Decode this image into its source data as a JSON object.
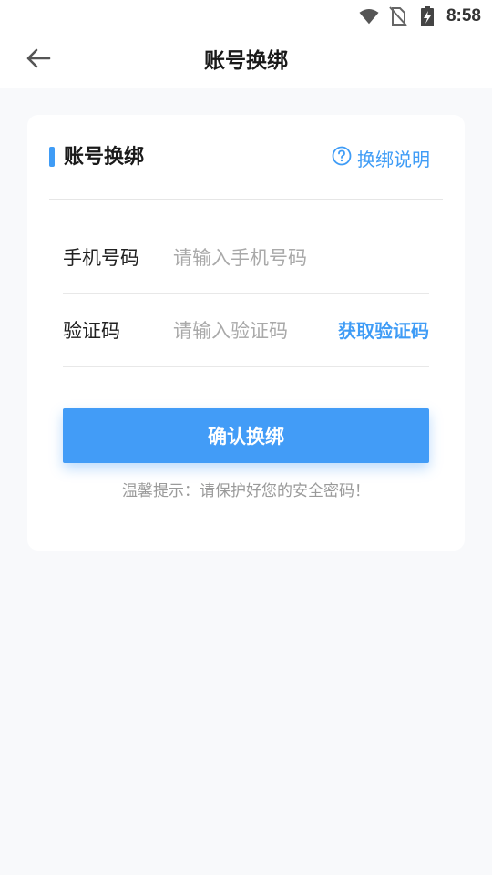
{
  "status_bar": {
    "time": "8:58",
    "icons": [
      "wifi-icon",
      "no-sim-icon",
      "battery-charging-icon"
    ]
  },
  "app_bar": {
    "back_icon": "arrow-left-icon",
    "title": "账号换绑"
  },
  "card": {
    "title": "账号换绑",
    "help_icon": "question-circle-icon",
    "help_label": "换绑说明",
    "phone": {
      "label": "手机号码",
      "value": "",
      "placeholder": "请输入手机号码"
    },
    "code": {
      "label": "验证码",
      "value": "",
      "placeholder": "请输入验证码",
      "get_code_label": "获取验证码"
    },
    "confirm_label": "确认换绑",
    "tip": "温馨提示：请保护好您的安全密码！"
  },
  "colors": {
    "accent": "#3f9cf6",
    "button": "#429cf7",
    "background": "#f8f9fb",
    "placeholder": "#a9a9a9"
  }
}
